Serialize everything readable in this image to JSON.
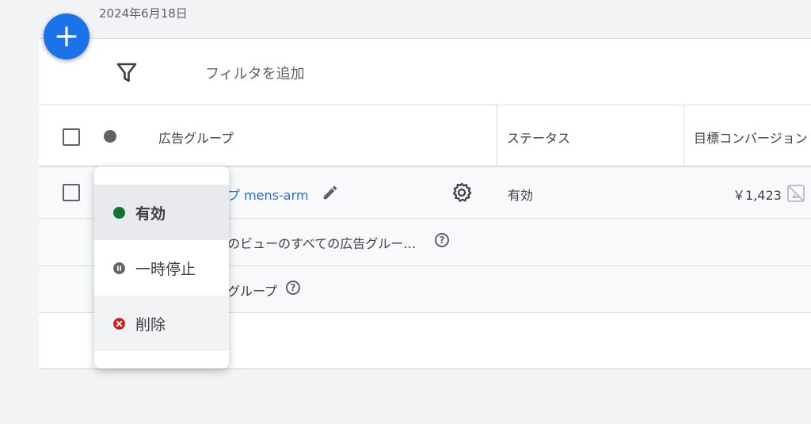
{
  "header": {
    "date": "2024年6月18日"
  },
  "filter": {
    "label": "フィルタを追加"
  },
  "columns": {
    "ad_group": "広告グループ",
    "status": "ステータス",
    "target": "目標コンバージョン"
  },
  "rows": {
    "r1": {
      "name": "プ mens-arm",
      "status": "有効",
      "value": "￥1,423"
    },
    "r2": {
      "text": "のビューのすべての広告グルー…"
    },
    "r3": {
      "text": "グループ"
    }
  },
  "menu": {
    "items": [
      {
        "label": "有効",
        "color": "#137333"
      },
      {
        "label": "一時停止",
        "color": "#5f6368"
      },
      {
        "label": "削除",
        "color": "#c5221f"
      }
    ]
  },
  "colors": {
    "accent": "#1a73e8",
    "enabled": "#137333",
    "removed": "#c5221f"
  }
}
